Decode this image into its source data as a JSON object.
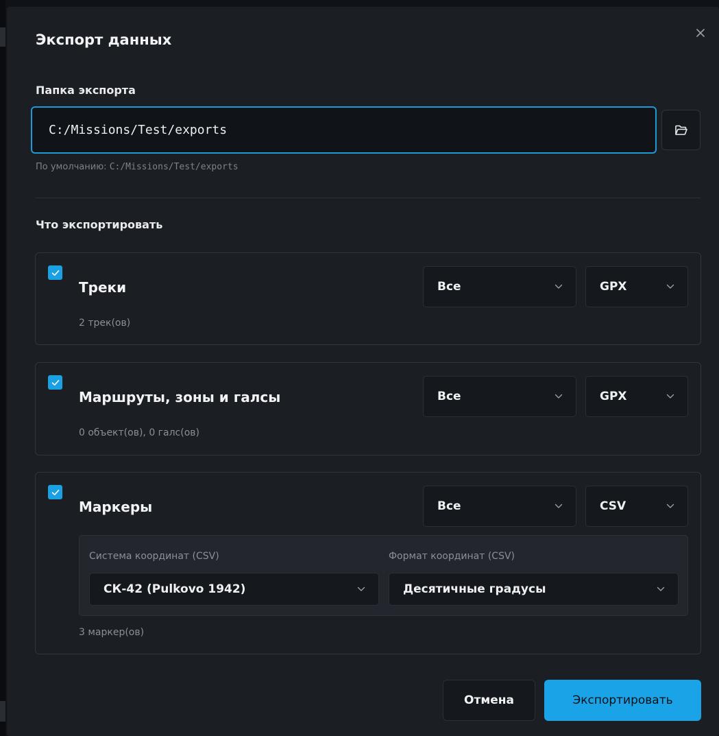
{
  "dialog": {
    "title": "Экспорт данных",
    "close_icon": "close-icon"
  },
  "export_folder": {
    "label": "Папка экспорта",
    "value": "C:/Missions/Test/exports",
    "browse_icon": "folder-open-icon",
    "hint_prefix": "По умолчанию: ",
    "hint_path": "C:/Missions/Test/exports"
  },
  "what_to_export": {
    "label": "Что экспортировать"
  },
  "sections": [
    {
      "checked": true,
      "title": "Треки",
      "subtitle": "2 трек(ов)",
      "scope": "Все",
      "format": "GPX"
    },
    {
      "checked": true,
      "title": "Маршруты, зоны и галсы",
      "subtitle": "0 объект(ов), 0 галс(ов)",
      "scope": "Все",
      "format": "GPX"
    },
    {
      "checked": true,
      "title": "Маркеры",
      "subtitle": "3 маркер(ов)",
      "scope": "Все",
      "format": "CSV",
      "csv_options": {
        "crs_label": "Система координат (CSV)",
        "crs_value": "СК-42 (Pulkovo 1942)",
        "coord_format_label": "Формат координат (CSV)",
        "coord_format_value": "Десятичные градусы"
      }
    }
  ],
  "footer": {
    "cancel_label": "Отмена",
    "export_label": "Экспортировать"
  },
  "colors": {
    "accent": "#1aa3e6",
    "dialog_bg": "#1b1e23",
    "input_border_focus": "#1e9ad6"
  }
}
